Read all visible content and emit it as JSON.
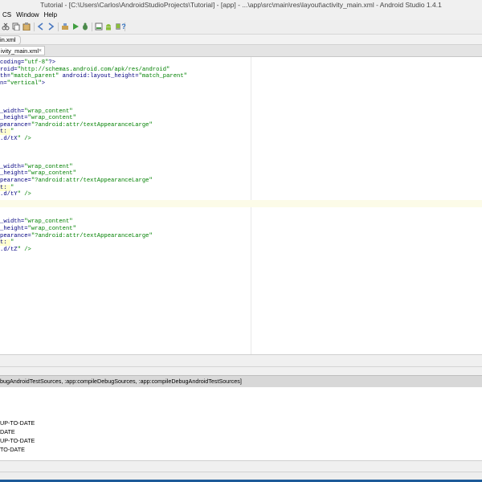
{
  "window": {
    "title": "Tutorial - [C:\\Users\\Carlos\\AndroidStudioProjects\\Tutorial] - [app] - ...\\app\\src\\main\\res\\layout\\activity_main.xml - Android Studio 1.4.1"
  },
  "menu": {
    "items": [
      "CS",
      "Window",
      "Help"
    ]
  },
  "toolbar": {
    "icons": [
      "cut-icon",
      "copy-icon",
      "paste-icon",
      "back-icon",
      "forward-icon",
      "build-icon",
      "run-icon",
      "debug-icon",
      "sdk-manager-icon",
      "avd-manager-icon",
      "android-icon",
      "help-icon"
    ],
    "help_glyph": "?"
  },
  "navbar": {
    "crumb": "in.xml"
  },
  "tabs": [
    {
      "label": "ivity_main.xml",
      "close": "×"
    }
  ],
  "editor": {
    "lines": [
      [
        "coding=\"utf-8\"?>"
      ],
      [
        "roid=\"http://schemas.android.com/apk/res/android\""
      ],
      [
        "th=\"match_parent\" android:layout_height=\"match_parent\""
      ],
      [
        "n=\"vertical\">"
      ],
      [
        ""
      ],
      [
        ""
      ],
      [
        "_width=\"wrap_content\""
      ],
      [
        "_height=\"wrap_content\""
      ],
      [
        "pearance=\"?android:attr/textAppearanceLarge\""
      ],
      [
        "t: \""
      ],
      [
        ".d/tX\" />"
      ],
      [
        ""
      ],
      [
        ""
      ],
      [
        "_width=\"wrap_content\""
      ],
      [
        "_height=\"wrap_content\""
      ],
      [
        "pearance=\"?android:attr/textAppearanceLarge\""
      ],
      [
        "t: \""
      ],
      [
        ".d/tY\" />"
      ],
      [
        ""
      ],
      [
        ""
      ],
      [
        ""
      ],
      [
        "_width=\"wrap_content\""
      ],
      [
        "_height=\"wrap_content\""
      ],
      [
        "pearance=\"?android:attr/textAppearanceLarge\""
      ],
      [
        "t: \""
      ],
      [
        ".d/tZ\" />"
      ]
    ]
  },
  "messages": {
    "header": "bugAndroidTestSources, :app:compileDebugSources, :app:compileDebugAndroidTestSources]",
    "lines": [
      "UP-TO-DATE",
      "DATE",
      "UP-TO-DATE",
      "TO-DATE"
    ]
  }
}
